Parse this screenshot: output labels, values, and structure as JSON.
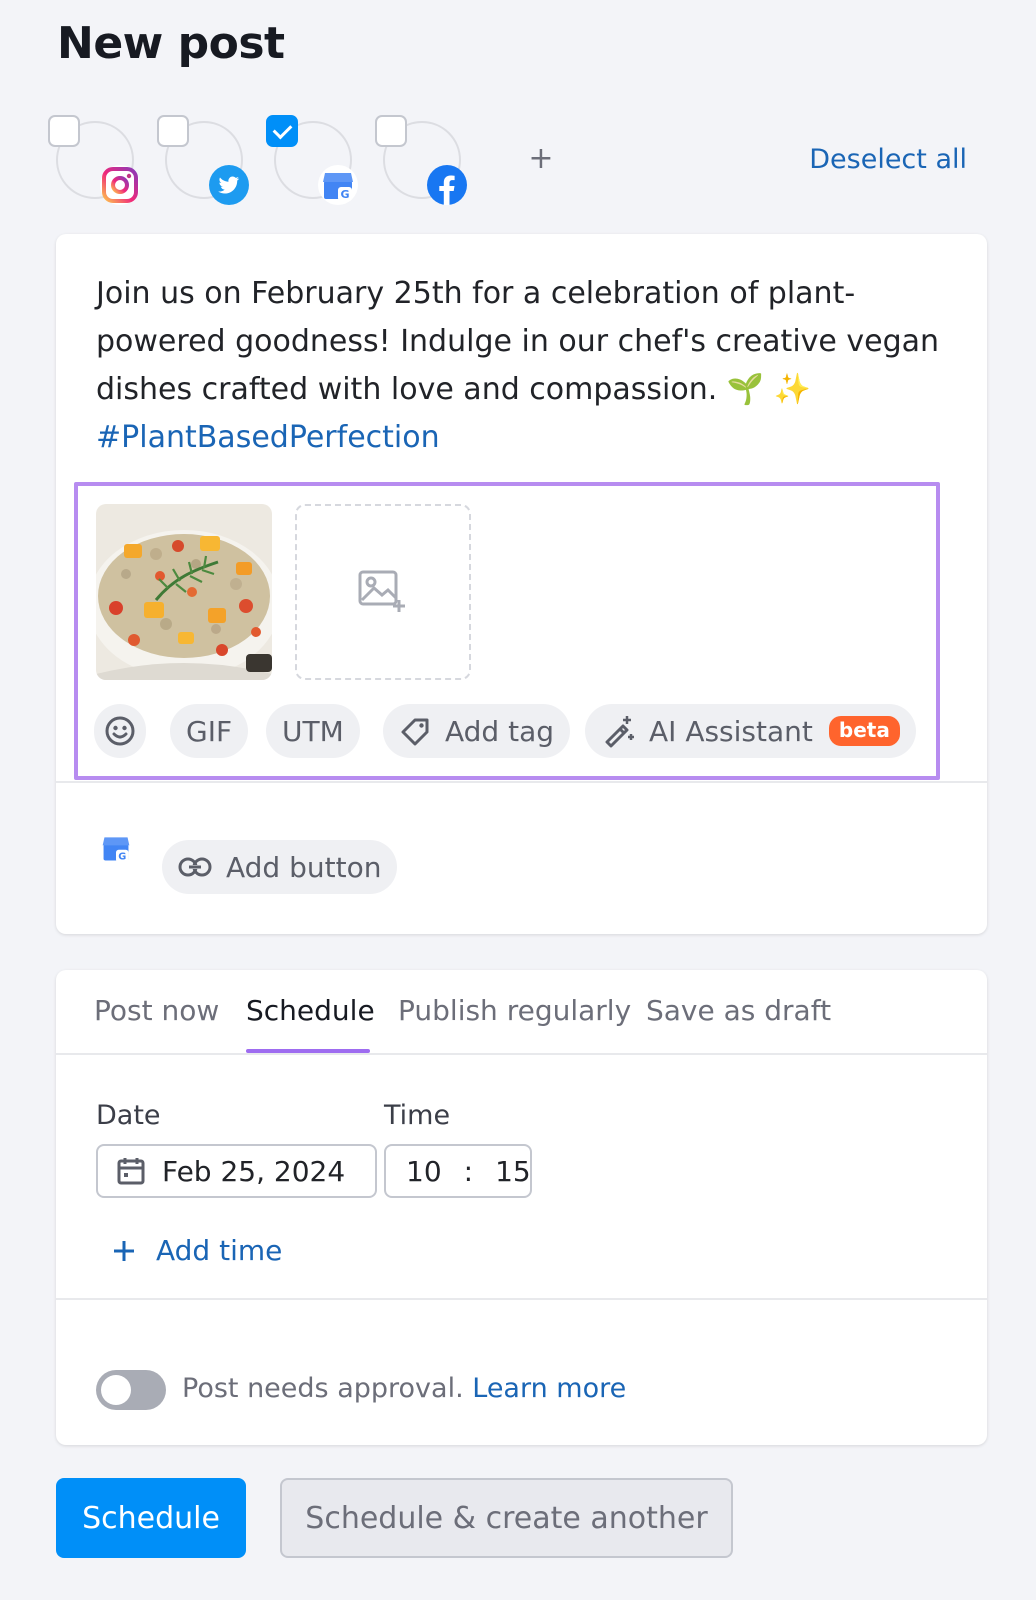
{
  "page": {
    "title": "New post"
  },
  "accounts": [
    {
      "network": "Instagram",
      "icon": "instagram-icon",
      "selected": false
    },
    {
      "network": "Twitter",
      "icon": "twitter-icon",
      "selected": false
    },
    {
      "network": "Google Business Profile",
      "icon": "google-business-icon",
      "selected": true
    },
    {
      "network": "Facebook",
      "icon": "facebook-icon",
      "selected": false
    }
  ],
  "accounts_bar": {
    "add_symbol": "+",
    "deselect_label": "Deselect all"
  },
  "post": {
    "text": "Join us on February 25th for a celebration of plant-powered goodness! Indulge in our chef's creative vegan dishes crafted with love and compassion.",
    "emojis": "🌱 ✨",
    "hashtag": "#PlantBasedPerfection"
  },
  "toolbar": {
    "emoji_icon": "smiley-icon",
    "gif_label": "GIF",
    "utm_label": "UTM",
    "tag_label": "Add tag",
    "ai_label": "AI Assistant",
    "ai_badge": "beta"
  },
  "gbp": {
    "add_button_label": "Add button"
  },
  "publish": {
    "tabs": [
      "Post now",
      "Schedule",
      "Publish regularly",
      "Save as draft"
    ],
    "active_tab": "Schedule",
    "date_label": "Date",
    "date_value": "Feb 25, 2024",
    "time_label": "Time",
    "time_hour": "10",
    "time_separator": ":",
    "time_minute": "15",
    "add_time_label": "Add time",
    "approval_text": "Post needs approval.",
    "approval_link": "Learn more",
    "approval_enabled": false
  },
  "actions": {
    "primary_label": "Schedule",
    "secondary_label": "Schedule & create another"
  },
  "colors": {
    "accent_blue": "#008ff8",
    "link_blue": "#1a65b5",
    "highlight_purple": "#b78cf0",
    "tab_underline": "#9e6cf0",
    "beta_orange": "#ff642d"
  }
}
